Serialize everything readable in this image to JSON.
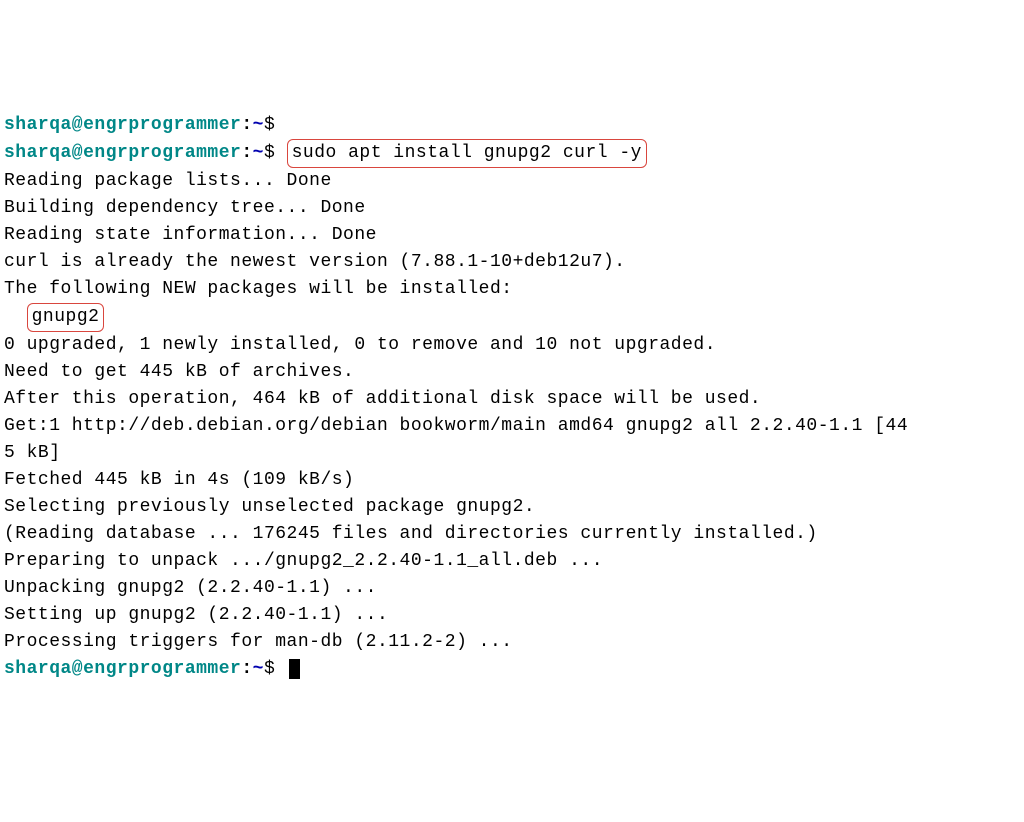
{
  "prompt": {
    "user": "sharqa@engrprogrammer",
    "colon": ":",
    "path": "~",
    "dollar": "$"
  },
  "command": "sudo apt install gnupg2 curl -y",
  "highlighted_package": "gnupg2",
  "output": {
    "l1": "Reading package lists... Done",
    "l2": "Building dependency tree... Done",
    "l3": "Reading state information... Done",
    "l4": "curl is already the newest version (7.88.1-10+deb12u7).",
    "l5": "The following NEW packages will be installed:",
    "l6_indent": "  ",
    "l7": "0 upgraded, 1 newly installed, 0 to remove and 10 not upgraded.",
    "l8": "Need to get 445 kB of archives.",
    "l9": "After this operation, 464 kB of additional disk space will be used.",
    "l10": "Get:1 http://deb.debian.org/debian bookworm/main amd64 gnupg2 all 2.2.40-1.1 [44",
    "l11": "5 kB]",
    "l12": "Fetched 445 kB in 4s (109 kB/s)",
    "l13": "Selecting previously unselected package gnupg2.",
    "l14": "(Reading database ... 176245 files and directories currently installed.)",
    "l15": "Preparing to unpack .../gnupg2_2.2.40-1.1_all.deb ...",
    "l16": "Unpacking gnupg2 (2.2.40-1.1) ...",
    "l17": "Setting up gnupg2 (2.2.40-1.1) ...",
    "l18": "Processing triggers for man-db (2.11.2-2) ..."
  }
}
